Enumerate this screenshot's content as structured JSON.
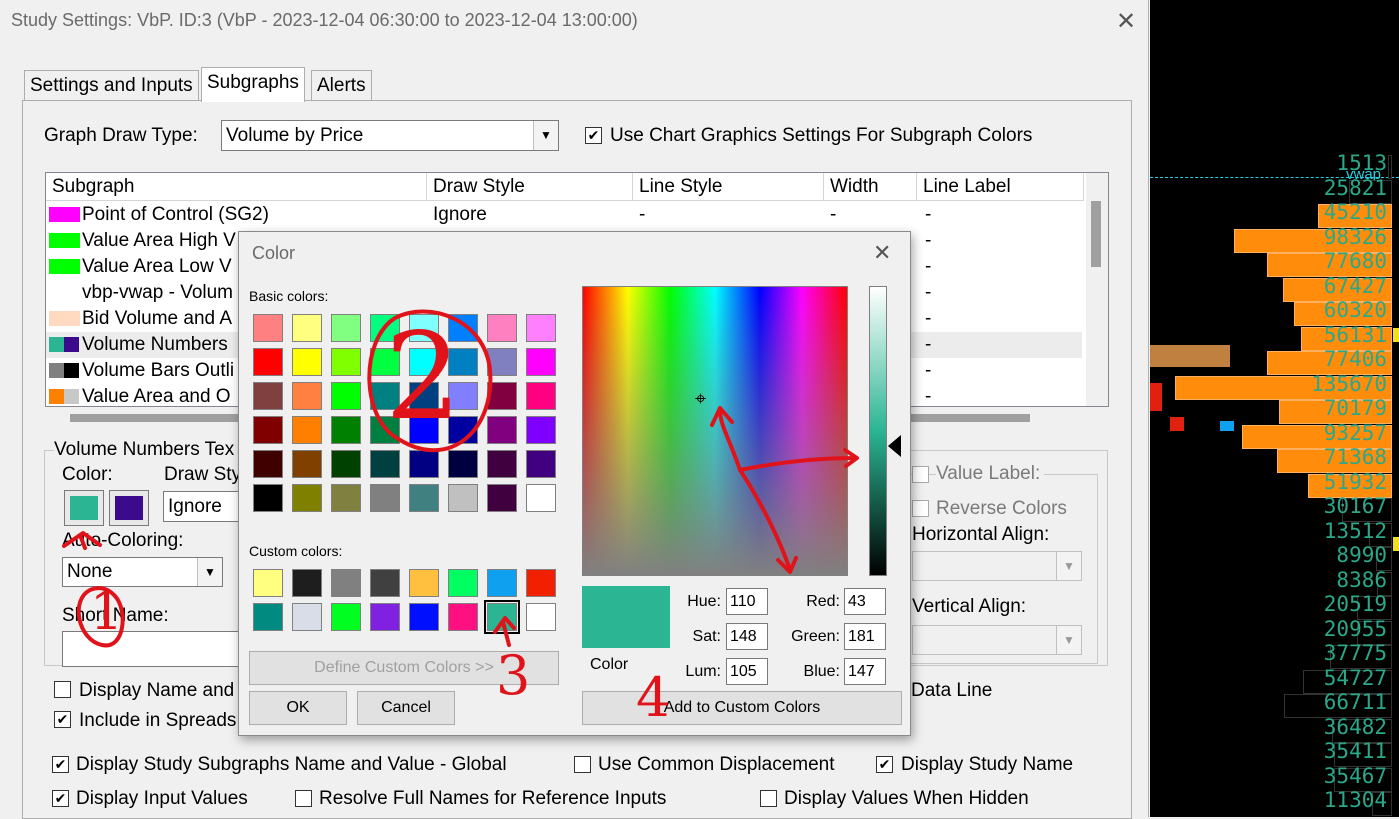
{
  "dialog": {
    "title": "Study Settings: VbP. ID:3 (VbP - 2023-12-04  06:30:00 to 2023-12-04  13:00:00)",
    "close": "✕",
    "tabs": [
      "Settings and Inputs",
      "Subgraphs",
      "Alerts"
    ]
  },
  "graph_draw_type": {
    "label": "Graph Draw Type:",
    "value": "Volume by Price"
  },
  "use_chart_graphics": {
    "label": "Use Chart Graphics Settings For Subgraph Colors",
    "checked": true
  },
  "subgraph_table": {
    "headers": [
      "Subgraph",
      "Draw Style",
      "Line Style",
      "Width",
      "Line Label"
    ],
    "rows": [
      {
        "name": "Point of Control (SG2)",
        "draw_style": "Ignore",
        "line_style": "-",
        "width": "-",
        "line_label": "-",
        "colors": [
          "#ff00ff"
        ]
      },
      {
        "name": "Value Area High V",
        "line_label": "-",
        "colors": [
          "#00ff00"
        ]
      },
      {
        "name": "Value Area Low V",
        "line_label": "-",
        "colors": [
          "#00ff00"
        ]
      },
      {
        "name": "vbp-vwap - Volum",
        "line_label": "-",
        "colors": []
      },
      {
        "name": "Bid Volume and A",
        "line_label": "-",
        "colors": [
          "#ffdac0"
        ]
      },
      {
        "name": "Volume Numbers",
        "line_label": "-",
        "colors": [
          "#2bb593",
          "#3c0b8c"
        ]
      },
      {
        "name": "Volume Bars Outli",
        "line_label": "-",
        "colors": [
          "#808080",
          "#000000"
        ]
      },
      {
        "name": "Value Area and O",
        "line_label": "-",
        "colors": [
          "#ff8000",
          "#c8c8c8"
        ]
      }
    ]
  },
  "volume_numbers": {
    "group_label": "Volume Numbers Tex",
    "color_label": "Color:",
    "colors": [
      "#2bb593",
      "#3c0b8c"
    ],
    "draw_style_label": "Draw Sty",
    "draw_style_value": "Ignore",
    "auto_coloring_label": "Auto-Coloring:",
    "auto_coloring_value": "None",
    "short_name_label": "Short Name:",
    "display_name_label": "Display Name and",
    "include_spreadsheet_label": "Include in Spreads",
    "value_label": "Value Label:",
    "reverse_colors": "Reverse Colors",
    "horizontal_align": "Horizontal Align:",
    "vertical_align": "Vertical Align:",
    "data_line": "Data Line"
  },
  "bottom_checks": [
    {
      "label": "Display Study Subgraphs Name and Value - Global",
      "checked": true
    },
    {
      "label": "Use Common Displacement",
      "checked": false
    },
    {
      "label": "Display Study Name",
      "checked": true
    },
    {
      "label": "Display Input Values",
      "checked": true
    },
    {
      "label": "Resolve Full Names for Reference Inputs",
      "checked": false
    },
    {
      "label": "Display Values When Hidden",
      "checked": false
    }
  ],
  "color_dialog": {
    "title": "Color",
    "close": "✕",
    "basic_label": "Basic colors:",
    "custom_label": "Custom colors:",
    "basic_colors": [
      "#ff8080",
      "#ffff80",
      "#80ff80",
      "#00ff80",
      "#80ffff",
      "#0080ff",
      "#ff80c0",
      "#ff80ff",
      "#ff0000",
      "#ffff00",
      "#80ff00",
      "#00ff40",
      "#00ffff",
      "#0080c0",
      "#8080c0",
      "#ff00ff",
      "#804040",
      "#ff8040",
      "#00ff00",
      "#008080",
      "#004080",
      "#8080ff",
      "#800040",
      "#ff0080",
      "#800000",
      "#ff8000",
      "#008000",
      "#008040",
      "#0000ff",
      "#0000a0",
      "#800080",
      "#8000ff",
      "#400000",
      "#804000",
      "#004000",
      "#004040",
      "#000080",
      "#000040",
      "#400040",
      "#400080",
      "#000000",
      "#808000",
      "#808040",
      "#808080",
      "#408080",
      "#c0c0c0",
      "#400040",
      "#ffffff"
    ],
    "custom_colors": [
      "#ffff80",
      "#1e1e1e",
      "#808080",
      "#404040",
      "#ffc040",
      "#00ff60",
      "#10a0f0",
      "#f02000",
      "#008a80",
      "#d8dde8",
      "#00ff20",
      "#8020e0",
      "#0010ff",
      "#ff1080",
      "#2bb593",
      "#ffffff"
    ],
    "define_custom": "Define Custom Colors >>",
    "ok": "OK",
    "cancel": "Cancel",
    "preview_label": "Color",
    "preview_color": "#2bb593",
    "hue_label": "Hue:",
    "hue": "110",
    "sat_label": "Sat:",
    "sat": "148",
    "lum_label": "Lum:",
    "lum": "105",
    "red_label": "Red:",
    "red": "43",
    "green_label": "Green:",
    "green": "181",
    "blue_label": "Blue:",
    "blue": "147",
    "add_custom": "Add to Custom Colors"
  },
  "annotations": {
    "one": "1",
    "two": "2",
    "three": "3",
    "four": "4"
  },
  "chart": {
    "vwap_label": "vwap",
    "volume_values": [
      "1513",
      "25821",
      "45210",
      "98326",
      "77680",
      "67427",
      "60320",
      "56131",
      "77406",
      "135670",
      "70179",
      "93257",
      "71368",
      "51932",
      "30167",
      "13512",
      "8990",
      "8386",
      "20519",
      "20955",
      "37775",
      "54727",
      "66711",
      "36482",
      "35411",
      "35467",
      "11304"
    ]
  }
}
